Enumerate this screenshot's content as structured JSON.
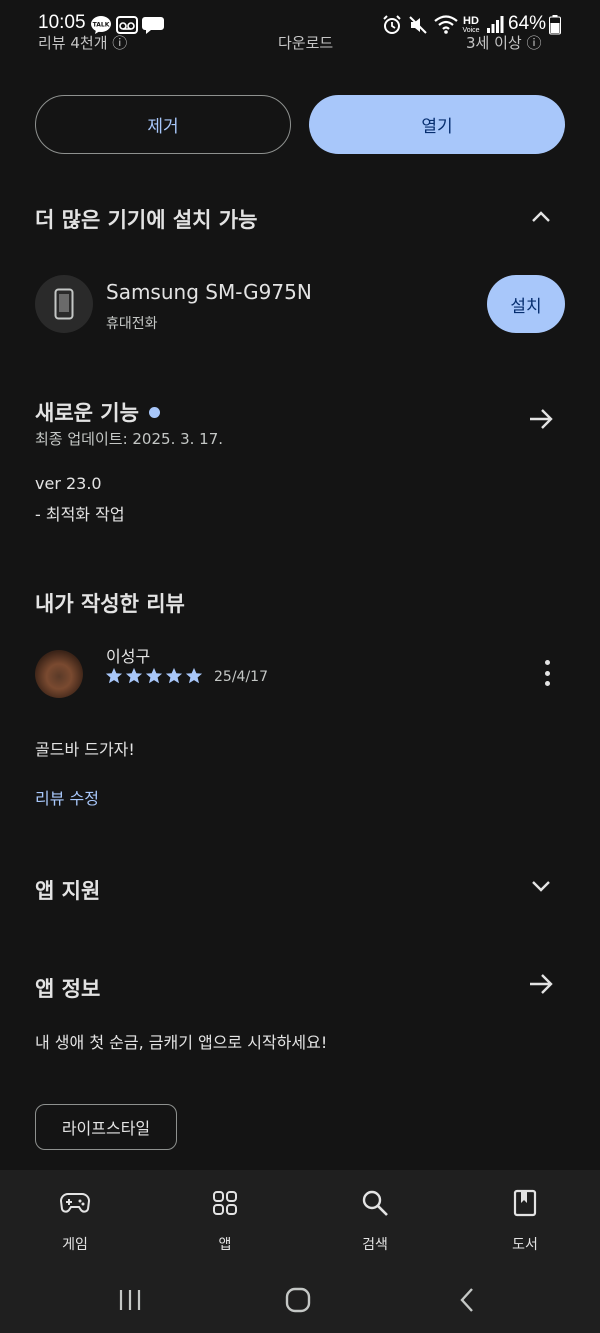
{
  "status_bar": {
    "time": "10:05",
    "talk_label": "TALK",
    "hd_label": "HD",
    "voice_label": "Voice",
    "battery": "64%"
  },
  "cutoff": {
    "left": "리뷰 4천개 ⓘ",
    "center": "다운로드",
    "right": "3세 이상 ⓘ"
  },
  "actions": {
    "remove_label": "제거",
    "open_label": "열기"
  },
  "devices": {
    "title": "더 많은 기기에 설치 가능",
    "device_name": "Samsung SM-G975N",
    "device_type": "휴대전화",
    "install_label": "설치"
  },
  "whats_new": {
    "title": "새로운 기능",
    "updated": "최종 업데이트: 2025. 3. 17.",
    "version": "ver 23.0",
    "note": "- 최적화 작업"
  },
  "my_review": {
    "title": "내가 작성한 리뷰",
    "reviewer": "이성구",
    "rating": 5,
    "date": "25/4/17",
    "text": "골드바 드가자!",
    "edit_label": "리뷰 수정"
  },
  "app_support": {
    "title": "앱 지원"
  },
  "app_info": {
    "title": "앱 정보",
    "description": "내 생애 첫 순금, 금캐기 앱으로 시작하세요!",
    "category_chip": "라이프스타일"
  },
  "bottom_nav": [
    {
      "label": "게임",
      "icon": "gamepad-icon"
    },
    {
      "label": "앱",
      "icon": "apps-grid-icon"
    },
    {
      "label": "검색",
      "icon": "search-icon"
    },
    {
      "label": "도서",
      "icon": "book-icon"
    }
  ],
  "colors": {
    "background": "#141414",
    "accent": "#a8c7fa",
    "accent_text": "#062e6f",
    "star": "#a8c7fa"
  }
}
